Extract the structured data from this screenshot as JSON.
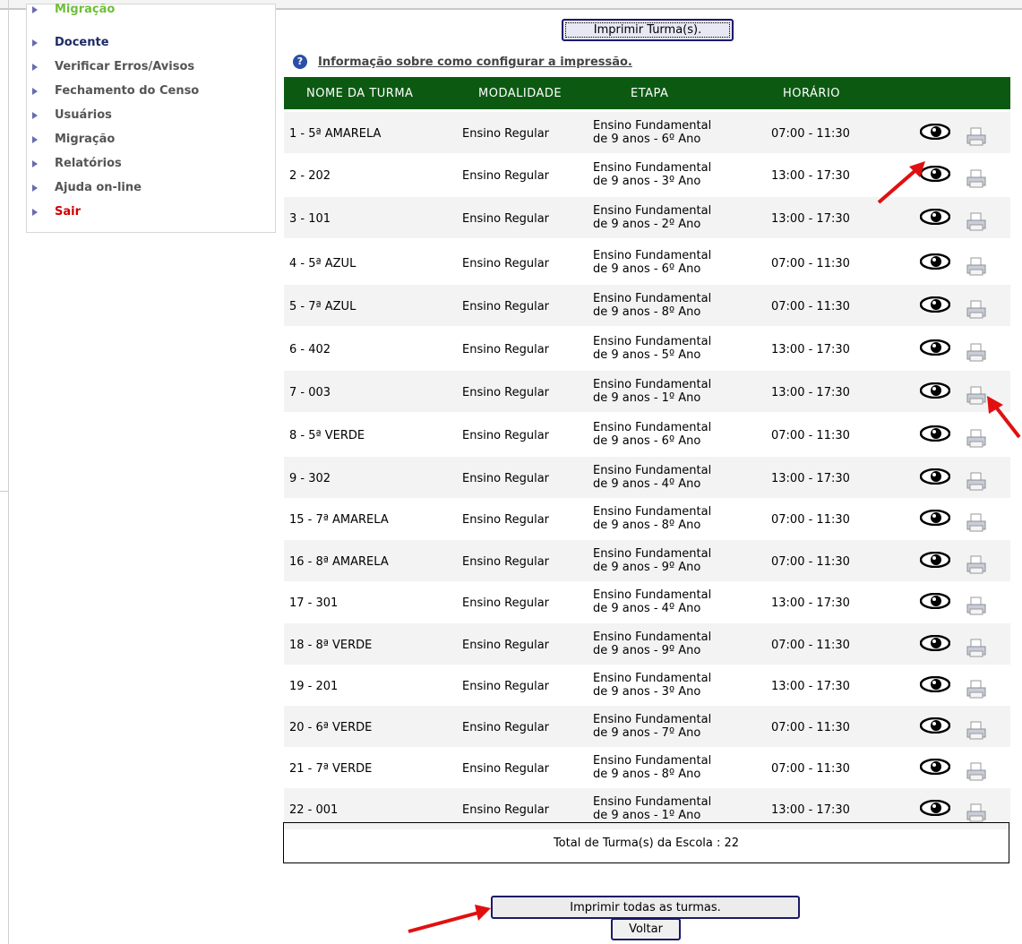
{
  "sidebar": {
    "items": [
      {
        "label": "Migração",
        "style": "green"
      },
      {
        "label": "Docente",
        "style": "dark"
      },
      {
        "label": "Verificar Erros/Avisos",
        "style": "gray"
      },
      {
        "label": "Fechamento do Censo",
        "style": "gray"
      },
      {
        "label": "Usuários",
        "style": "gray"
      },
      {
        "label": "Migração",
        "style": "gray"
      },
      {
        "label": "Relatórios",
        "style": "gray"
      },
      {
        "label": "Ajuda on-line",
        "style": "gray"
      },
      {
        "label": "Sair",
        "style": "red"
      }
    ]
  },
  "toolbar": {
    "print_selected_label": "Imprimir Turma(s).",
    "info_link": "Informação sobre como configurar a impressão.",
    "info_icon": "question-icon"
  },
  "table": {
    "headers": [
      "NOME DA TURMA",
      "MODALIDADE",
      "ETAPA",
      "HORÁRIO"
    ],
    "rows": [
      {
        "name": "1 - 5ª AMARELA",
        "mod": "Ensino Regular",
        "etapa1": "Ensino Fundamental",
        "etapa2": "de 9 anos - 6º Ano",
        "hor": "07:00 - 11:30"
      },
      {
        "name": "2 - 202",
        "mod": "Ensino Regular",
        "etapa1": "Ensino Fundamental",
        "etapa2": "de 9 anos - 3º Ano",
        "hor": "13:00 - 17:30"
      },
      {
        "name": "3 - 101",
        "mod": "Ensino Regular",
        "etapa1": "Ensino Fundamental",
        "etapa2": "de 9 anos - 2º Ano",
        "hor": "13:00 - 17:30"
      },
      {
        "name": "4 - 5ª AZUL",
        "mod": "Ensino Regular",
        "etapa1": "Ensino Fundamental",
        "etapa2": "de 9 anos - 6º Ano",
        "hor": "07:00 - 11:30"
      },
      {
        "name": "5 - 7ª AZUL",
        "mod": "Ensino Regular",
        "etapa1": "Ensino Fundamental",
        "etapa2": "de 9 anos - 8º Ano",
        "hor": "07:00 - 11:30"
      },
      {
        "name": "6 - 402",
        "mod": "Ensino Regular",
        "etapa1": "Ensino Fundamental",
        "etapa2": "de 9 anos - 5º Ano",
        "hor": "13:00 - 17:30"
      },
      {
        "name": "7 - 003",
        "mod": "Ensino Regular",
        "etapa1": "Ensino Fundamental",
        "etapa2": "de 9 anos - 1º Ano",
        "hor": "13:00 - 17:30"
      },
      {
        "name": "8 - 5ª VERDE",
        "mod": "Ensino Regular",
        "etapa1": "Ensino Fundamental",
        "etapa2": "de 9 anos - 6º Ano",
        "hor": "07:00 - 11:30"
      },
      {
        "name": "9 - 302",
        "mod": "Ensino Regular",
        "etapa1": "Ensino Fundamental",
        "etapa2": "de 9 anos - 4º Ano",
        "hor": "13:00 - 17:30"
      },
      {
        "name": "15 - 7ª AMARELA",
        "mod": "Ensino Regular",
        "etapa1": "Ensino Fundamental",
        "etapa2": "de 9 anos - 8º Ano",
        "hor": "07:00 - 11:30"
      },
      {
        "name": "16 - 8ª AMARELA",
        "mod": "Ensino Regular",
        "etapa1": "Ensino Fundamental",
        "etapa2": "de 9 anos - 9º Ano",
        "hor": "07:00 - 11:30"
      },
      {
        "name": "17 - 301",
        "mod": "Ensino Regular",
        "etapa1": "Ensino Fundamental",
        "etapa2": "de 9 anos - 4º Ano",
        "hor": "13:00 - 17:30"
      },
      {
        "name": "18 - 8ª VERDE",
        "mod": "Ensino Regular",
        "etapa1": "Ensino Fundamental",
        "etapa2": "de 9 anos - 9º Ano",
        "hor": "07:00 - 11:30"
      },
      {
        "name": "19 - 201",
        "mod": "Ensino Regular",
        "etapa1": "Ensino Fundamental",
        "etapa2": "de 9 anos - 3º Ano",
        "hor": "13:00 - 17:30"
      },
      {
        "name": "20 - 6ª VERDE",
        "mod": "Ensino Regular",
        "etapa1": "Ensino Fundamental",
        "etapa2": "de 9 anos - 7º Ano",
        "hor": "07:00 - 11:30"
      },
      {
        "name": "21 - 7ª VERDE",
        "mod": "Ensino Regular",
        "etapa1": "Ensino Fundamental",
        "etapa2": "de 9 anos - 8º Ano",
        "hor": "07:00 - 11:30"
      },
      {
        "name": "22 - 001",
        "mod": "Ensino Regular",
        "etapa1": "Ensino Fundamental",
        "etapa2": "de 9 anos - 1º Ano",
        "hor": "13:00 - 17:30"
      }
    ],
    "row_icons": [
      "eye-icon",
      "printer-icon"
    ]
  },
  "footer": {
    "total_label": "Total de Turma(s) da Escola : 22",
    "print_all_label": "Imprimir todas as turmas.",
    "back_label": "Voltar"
  },
  "colors": {
    "header_bg": "#0c5a12",
    "annotation_arrow": "#e01010",
    "exit_link": "#d00000"
  }
}
